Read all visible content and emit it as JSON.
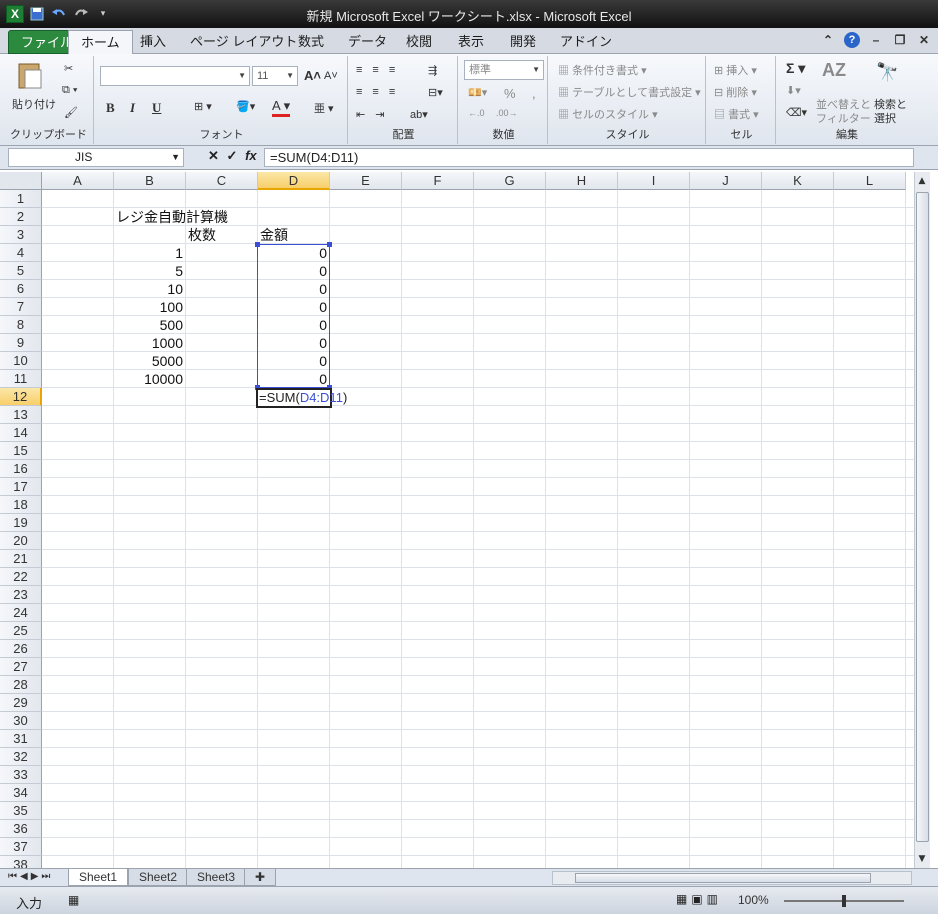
{
  "window": {
    "title": "新規 Microsoft Excel ワークシート.xlsx  -  Microsoft Excel",
    "logo": "X"
  },
  "tabs": [
    "ファイル",
    "ホーム",
    "挿入",
    "ページ レイアウト",
    "数式",
    "データ",
    "校閲",
    "表示",
    "開発",
    "アドイン"
  ],
  "active_tab": "ホーム",
  "ribbon": {
    "clipboard": {
      "paste": "貼り付け",
      "label": "クリップボード"
    },
    "font": {
      "name": "",
      "size": "11",
      "bold": "B",
      "italic": "I",
      "underline": "U",
      "label": "フォント",
      "font_color_glyph": "A",
      "grow": "A",
      "shrink": "A"
    },
    "alignment": {
      "label": "配置"
    },
    "number": {
      "format": "標準",
      "percent": "%",
      "comma": ",",
      "label": "数値"
    },
    "styles": {
      "conditional": "条件付き書式",
      "table": "テーブルとして書式設定",
      "cell_styles": "セルのスタイル",
      "label": "スタイル"
    },
    "cells": {
      "insert": "挿入",
      "delete": "削除",
      "format": "書式",
      "label": "セル"
    },
    "editing": {
      "sum": "Σ",
      "sort": "並べ替えと フィルター",
      "sort_line1": "並べ替えと",
      "sort_line2": "フィルター",
      "find_line1": "検索と",
      "find_line2": "選択",
      "label": "編集"
    }
  },
  "formula_bar": {
    "name_box": "JIS",
    "fx": "fx",
    "cancel": "✕",
    "enter": "✓",
    "formula_prefix": "=SUM(",
    "formula_ref": "D4:D11",
    "formula_suffix": ")"
  },
  "columns": [
    "A",
    "B",
    "C",
    "D",
    "E",
    "F",
    "G",
    "H",
    "I",
    "J",
    "K",
    "L"
  ],
  "selected_column": "D",
  "rows": [
    "1",
    "2",
    "3",
    "4",
    "5",
    "6",
    "7",
    "8",
    "9",
    "10",
    "11",
    "12",
    "13",
    "14",
    "15",
    "16",
    "17",
    "18",
    "19",
    "20",
    "21",
    "22",
    "23",
    "24",
    "25",
    "26",
    "27",
    "28",
    "29",
    "30",
    "31",
    "32",
    "33",
    "34",
    "35",
    "36",
    "37",
    "38"
  ],
  "selected_row": "12",
  "cells": {
    "B2": "レジ金自動計算機",
    "C3": "枚数",
    "D3": "金額",
    "B_values": [
      "1",
      "5",
      "10",
      "100",
      "500",
      "1000",
      "5000",
      "10000"
    ],
    "D_values": [
      "0",
      "0",
      "0",
      "0",
      "0",
      "0",
      "0",
      "0"
    ]
  },
  "edit_cell": {
    "address": "D12",
    "prefix": "=SUM(",
    "ref": "D4:D11",
    "suffix": ")"
  },
  "sheets": [
    "Sheet1",
    "Sheet2",
    "Sheet3"
  ],
  "active_sheet": "Sheet1",
  "status": {
    "mode": "入力",
    "zoom": "100%"
  },
  "colors": {
    "accent_ref": "#3b4fd6",
    "file_tab": "#2b8a3e",
    "selected_header": "#f7cf6a"
  }
}
